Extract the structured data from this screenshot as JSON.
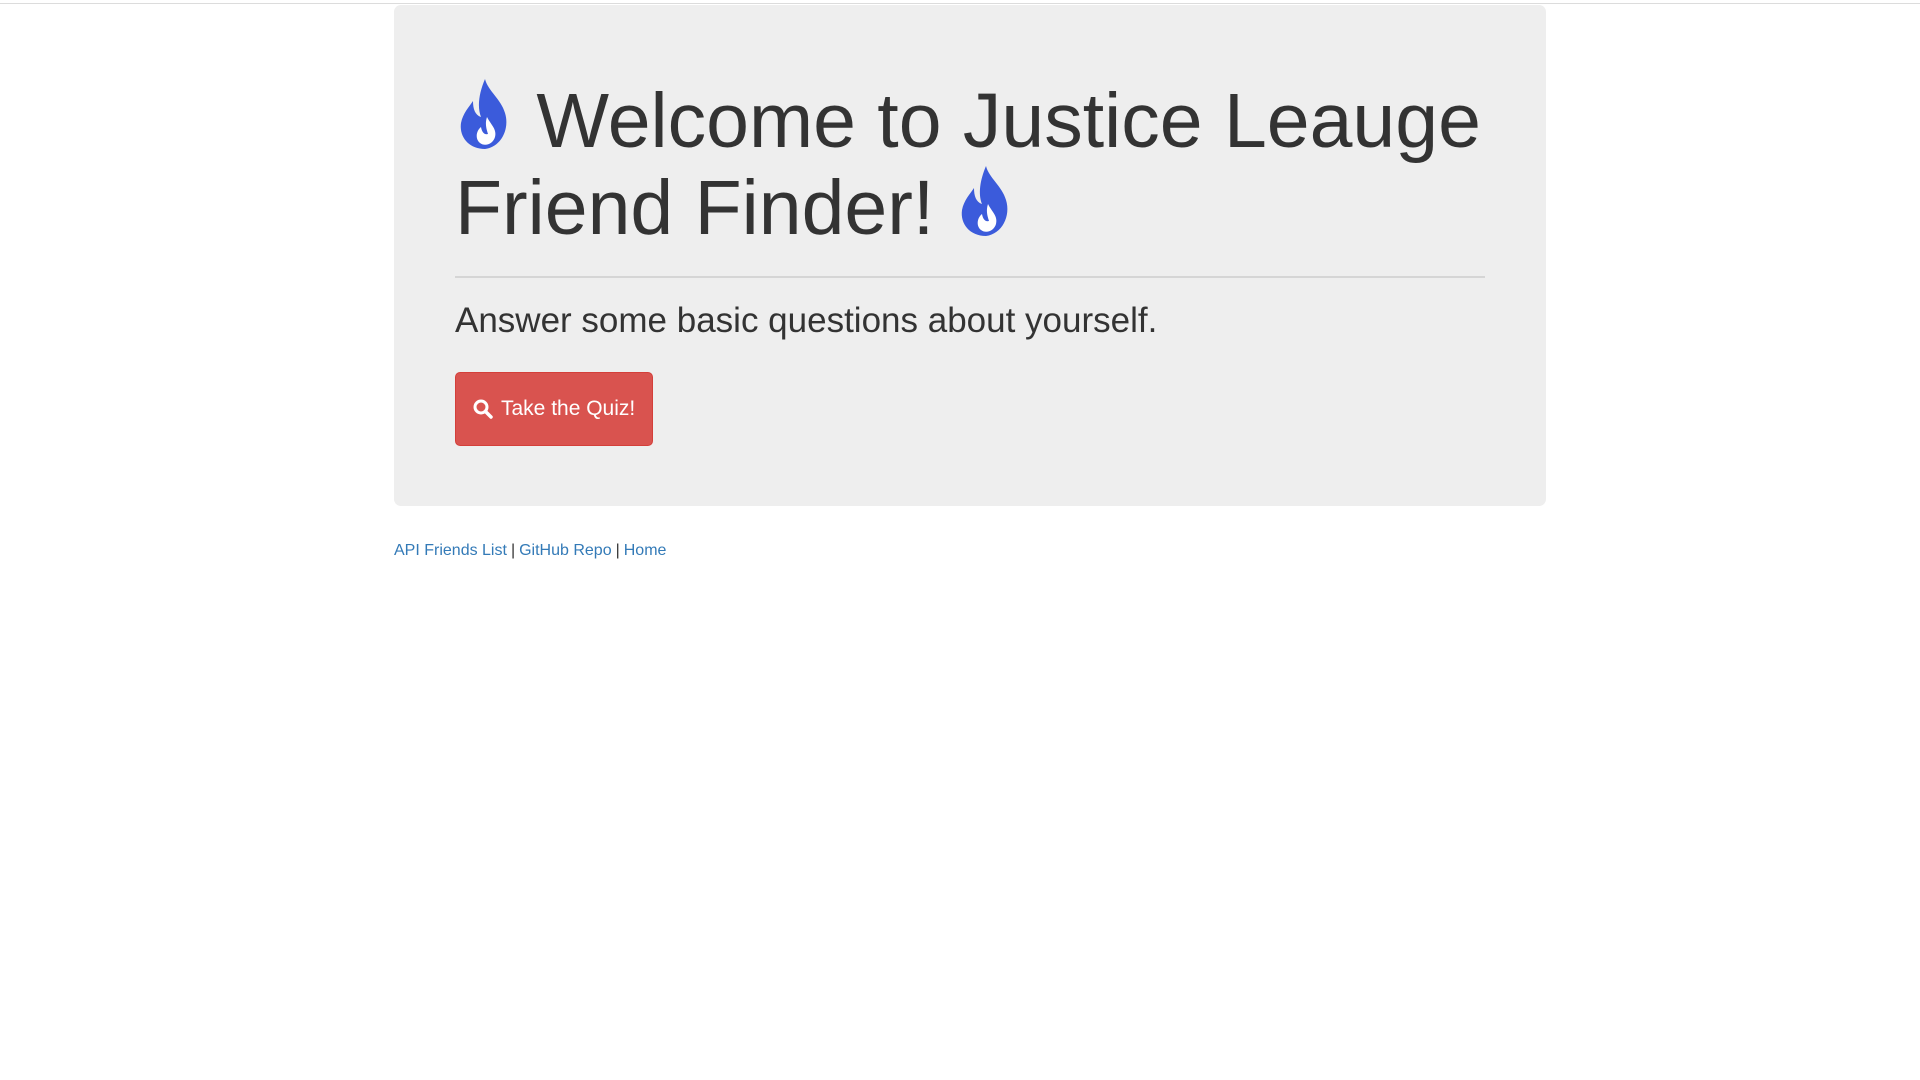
{
  "colors": {
    "flame": "#3b5bdb",
    "button": "#d9534f",
    "link": "#337ab7",
    "panel": "#eeeeee"
  },
  "header": {
    "title_line1": "Welcome to Justice Leauge",
    "title_line2": "Friend Finder!",
    "flame_icon": "fire-icon"
  },
  "main": {
    "lead": "Answer some basic questions about yourself.",
    "quiz_button_label": "Take the Quiz!",
    "quiz_button_icon": "search-icon"
  },
  "footer": {
    "links": [
      {
        "label": "API Friends List"
      },
      {
        "label": "GitHub Repo"
      },
      {
        "label": "Home"
      }
    ],
    "separator": "|"
  }
}
